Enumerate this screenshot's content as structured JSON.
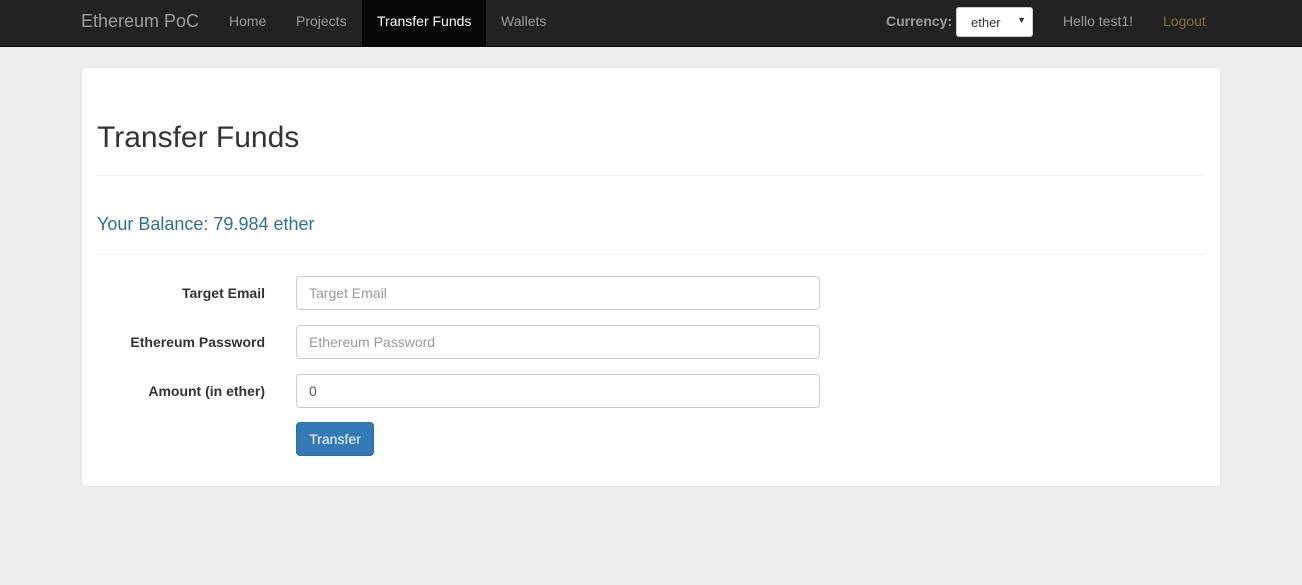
{
  "navbar": {
    "brand": "Ethereum PoC",
    "items": [
      {
        "label": "Home",
        "active": false
      },
      {
        "label": "Projects",
        "active": false
      },
      {
        "label": "Transfer Funds",
        "active": true
      },
      {
        "label": "Wallets",
        "active": false
      }
    ],
    "currency_label": "Currency:",
    "currency_value": "ether",
    "greeting": "Hello test1!",
    "logout": "Logout"
  },
  "main": {
    "title": "Transfer Funds",
    "balance": "Your Balance: 79.984 ether",
    "form": {
      "target_email": {
        "label": "Target Email",
        "placeholder": "Target Email",
        "value": ""
      },
      "password": {
        "label": "Ethereum Password",
        "placeholder": "Ethereum Password",
        "value": ""
      },
      "amount": {
        "label": "Amount (in ether)",
        "value": "0"
      },
      "submit": "Transfer"
    }
  },
  "colors": {
    "navbar_bg": "#222222",
    "active_bg": "#080808",
    "balance_text": "#31708f",
    "primary_button": "#337ab7",
    "logout_text": "#8a6d3b"
  }
}
